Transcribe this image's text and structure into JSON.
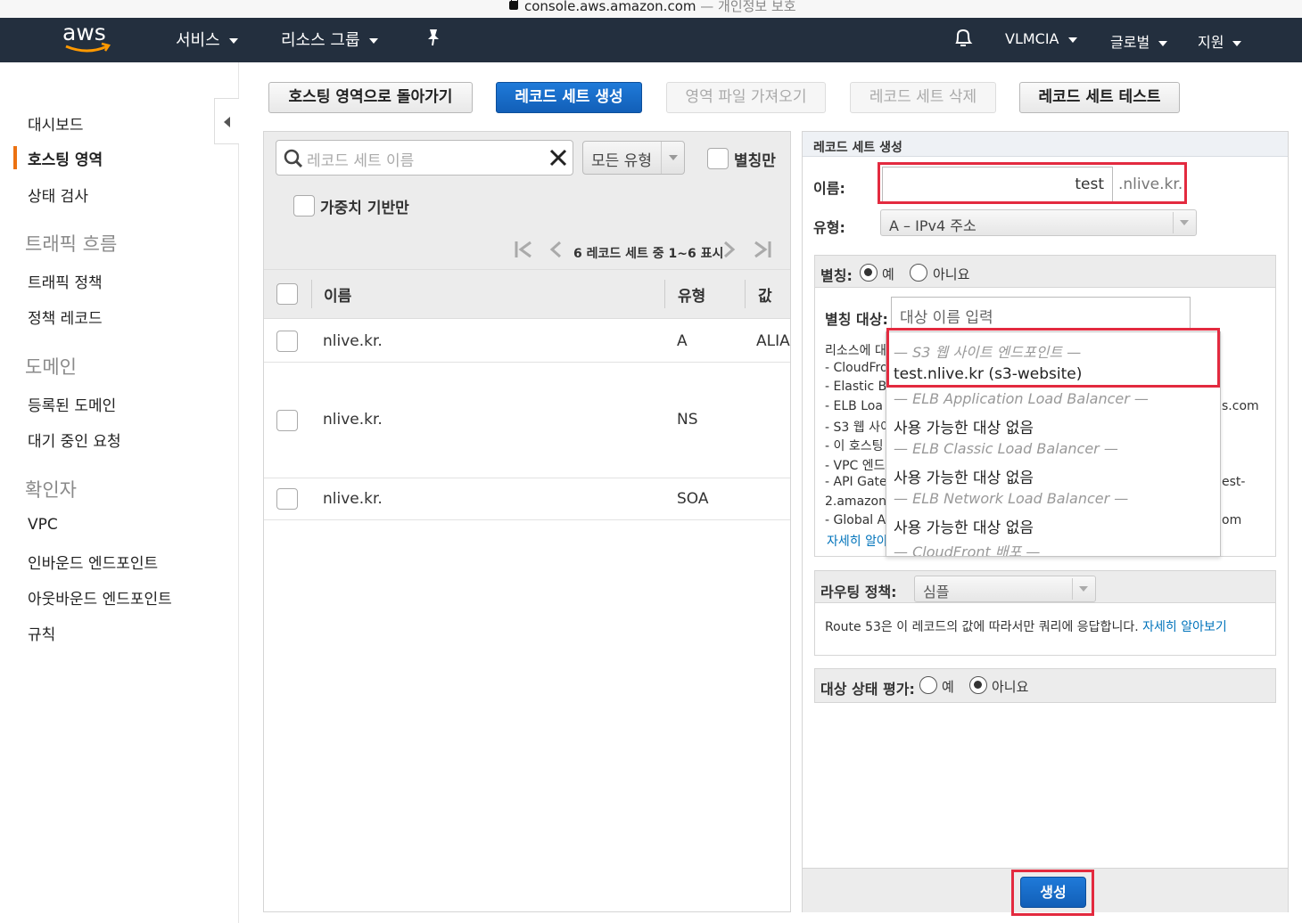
{
  "browser": {
    "url_host": "console.aws.amazon.com",
    "url_suffix": " — 개인정보 보호"
  },
  "topnav": {
    "logo": "aws",
    "services": "서비스",
    "resource_groups": "리소스 그룹",
    "account": "VLMCIA",
    "region": "글로벌",
    "support": "지원"
  },
  "sidebar": {
    "items": [
      {
        "label": "대시보드"
      },
      {
        "label": "호스팅 영역",
        "active": true
      },
      {
        "label": "상태 검사"
      }
    ],
    "sections": [
      {
        "title": "트래픽 흐름",
        "items": [
          "트래픽 정책",
          "정책 레코드"
        ]
      },
      {
        "title": "도메인",
        "items": [
          "등록된 도메인",
          "대기 중인 요청"
        ]
      },
      {
        "title": "확인자",
        "items": [
          "VPC",
          "인바운드 엔드포인트",
          "아웃바운드 엔드포인트",
          "규칙"
        ]
      }
    ]
  },
  "toolbar": {
    "back": "호스팅 영역으로 돌아가기",
    "create": "레코드 세트 생성",
    "import": "영역 파일 가져오기",
    "delete": "레코드 세트 삭제",
    "test": "레코드 세트 테스트"
  },
  "list": {
    "search_placeholder": "레코드 세트 이름",
    "type_filter": "모든 유형",
    "alias_only": "별칭만",
    "weighted_only": "가중치 기반만",
    "pager": "6 레코드 세트 중 1~6 표시",
    "columns": {
      "name": "이름",
      "type": "유형",
      "value": "값"
    },
    "rows": [
      {
        "name": "nlive.kr.",
        "type": "A",
        "value": "ALIA"
      },
      {
        "name": "nlive.kr.",
        "type": "NS",
        "value": ""
      },
      {
        "name": "nlive.kr.",
        "type": "SOA",
        "value": ""
      }
    ]
  },
  "form": {
    "header": "레코드 세트 생성",
    "name_label": "이름:",
    "name_value": "test",
    "name_suffix": ".nlive.kr.",
    "type_label": "유형:",
    "type_value": "A – IPv4 주소",
    "alias_label": "별칭:",
    "alias_yes": "예",
    "alias_no": "아니요",
    "alias_target_label": "별칭 대상:",
    "alias_target_placeholder": "대상 이름 입력",
    "help_lines": [
      "리소스에 대",
      "CloudFro",
      "Elastic B",
      "ELB Loa",
      "S3 웹 사이",
      "이 호스팅",
      "VPC 엔드",
      "API Gate",
      "2.amazona",
      "Global A"
    ],
    "help_prefix": "- ",
    "help_right_1": "s.com",
    "help_right_2": "est-",
    "help_right_3": "om",
    "help_link": "자세히 알아",
    "dropdown": [
      {
        "group": "— S3 웹 사이트 엔드포인트 —",
        "option": "test.nlive.kr (s3-website)"
      },
      {
        "group": "— ELB Application Load Balancer —",
        "option": "사용 가능한 대상 없음"
      },
      {
        "group": "— ELB Classic Load Balancer —",
        "option": "사용 가능한 대상 없음"
      },
      {
        "group": "— ELB Network Load Balancer —",
        "option": "사용 가능한 대상 없음"
      },
      {
        "group": "— CloudFront 배포 —",
        "option": ""
      }
    ],
    "routing_label": "라우팅 정책:",
    "routing_value": "심플",
    "routing_desc": "Route 53은 이 레코드의 값에 따라서만 쿼리에 응답합니다.",
    "routing_link": "자세히 알아보기",
    "health_label": "대상 상태 평가:",
    "health_yes": "예",
    "health_no": "아니요",
    "submit": "생성"
  },
  "colors": {
    "accent": "#ec7211",
    "primary": "#1a6dcc",
    "nav": "#232f3e",
    "highlight": "#e32a3f"
  }
}
